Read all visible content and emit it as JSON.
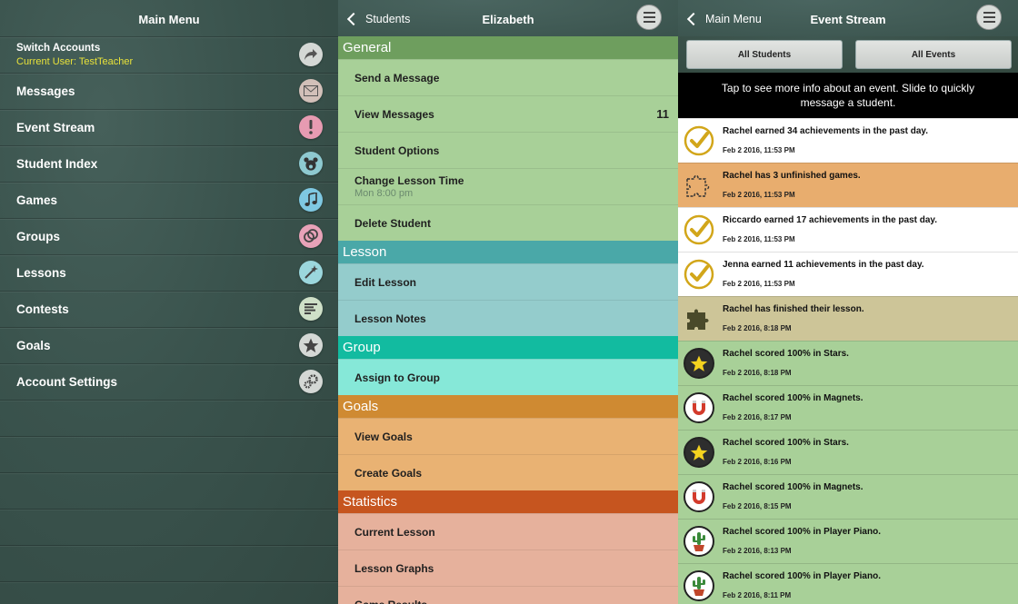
{
  "left": {
    "title": "Main Menu",
    "switch": {
      "label": "Switch Accounts",
      "current_user": "Current User: TestTeacher"
    },
    "items": [
      {
        "label": "Messages",
        "icon": "envelope-icon",
        "color": "#d2c0b9"
      },
      {
        "label": "Event Stream",
        "icon": "exclamation-icon",
        "color": "#e79bb2"
      },
      {
        "label": "Student Index",
        "icon": "bear-icon",
        "color": "#8ec9d0"
      },
      {
        "label": "Games",
        "icon": "music-note-icon",
        "color": "#7fc8e2"
      },
      {
        "label": "Groups",
        "icon": "rings-icon",
        "color": "#e8a2b8"
      },
      {
        "label": "Lessons",
        "icon": "magic-wand-icon",
        "color": "#9bd7dd"
      },
      {
        "label": "Contests",
        "icon": "list-icon",
        "color": "#cfe0c8"
      },
      {
        "label": "Goals",
        "icon": "star-icon",
        "color": "#d4d8d5"
      },
      {
        "label": "Account Settings",
        "icon": "gear-icon",
        "color": "#d4d8d5"
      }
    ]
  },
  "middle": {
    "back_label": "Students",
    "title": "Elizabeth",
    "sections": [
      {
        "title": "General",
        "header_color": "#6e9e5e",
        "row_color": "#a8d098",
        "items": [
          {
            "label": "Send a Message"
          },
          {
            "label": "View Messages",
            "count": "11"
          },
          {
            "label": "Student Options"
          },
          {
            "label": "Change Lesson Time",
            "sub": "Mon 8:00 pm"
          },
          {
            "label": "Delete Student"
          }
        ]
      },
      {
        "title": "Lesson",
        "header_color": "#4aa8a8",
        "row_color": "#94cccc",
        "items": [
          {
            "label": "Edit Lesson"
          },
          {
            "label": "Lesson Notes"
          }
        ]
      },
      {
        "title": "Group",
        "header_color": "#12bba0",
        "row_color": "#86e8d8",
        "items": [
          {
            "label": "Assign to Group"
          }
        ]
      },
      {
        "title": "Goals",
        "header_color": "#cf8a32",
        "row_color": "#e9b273",
        "items": [
          {
            "label": "View Goals"
          },
          {
            "label": "Create Goals"
          }
        ]
      },
      {
        "title": "Statistics",
        "header_color": "#c6551f",
        "row_color": "#e6b19c",
        "items": [
          {
            "label": "Current Lesson"
          },
          {
            "label": "Lesson Graphs"
          },
          {
            "label": "Game Results"
          }
        ]
      }
    ]
  },
  "right": {
    "back_label": "Main Menu",
    "title": "Event Stream",
    "filters": {
      "students": "All Students",
      "events": "All Events"
    },
    "info": "Tap to see more info about an event. Slide to quickly message a student.",
    "events": [
      {
        "text": "Rachel earned 34 achievements in the past day.",
        "time": "Feb 2 2016, 11:53 PM",
        "bg": "#ffffff",
        "icon": "checkmark-icon"
      },
      {
        "text": "Rachel has 3 unfinished games.",
        "time": "Feb 2 2016, 11:53 PM",
        "bg": "#e8ad6e",
        "icon": "puzzle-outline-icon"
      },
      {
        "text": "Riccardo earned 17 achievements in the past day.",
        "time": "Feb 2 2016, 11:53 PM",
        "bg": "#ffffff",
        "icon": "checkmark-icon"
      },
      {
        "text": "Jenna earned 11 achievements in the past day.",
        "time": "Feb 2 2016, 11:53 PM",
        "bg": "#ffffff",
        "icon": "checkmark-icon"
      },
      {
        "text": "Rachel has finished their lesson.",
        "time": "Feb 2 2016, 8:18 PM",
        "bg": "#cdc598",
        "icon": "puzzle-filled-icon"
      },
      {
        "text": "Rachel scored 100% in Stars.",
        "time": "Feb 2 2016, 8:18 PM",
        "bg": "#a8d098",
        "icon": "star-badge-icon"
      },
      {
        "text": "Rachel scored 100% in Magnets.",
        "time": "Feb 2 2016, 8:17 PM",
        "bg": "#a8d098",
        "icon": "magnet-badge-icon"
      },
      {
        "text": "Rachel scored 100% in Stars.",
        "time": "Feb 2 2016, 8:16 PM",
        "bg": "#a8d098",
        "icon": "star-badge-icon"
      },
      {
        "text": "Rachel scored 100% in Magnets.",
        "time": "Feb 2 2016, 8:15 PM",
        "bg": "#a8d098",
        "icon": "magnet-badge-icon"
      },
      {
        "text": "Rachel scored 100% in Player Piano.",
        "time": "Feb 2 2016, 8:13 PM",
        "bg": "#a8d098",
        "icon": "cactus-badge-icon"
      },
      {
        "text": "Rachel scored 100% in Player Piano.",
        "time": "Feb 2 2016, 8:11 PM",
        "bg": "#a8d098",
        "icon": "cactus-badge-icon"
      }
    ]
  }
}
